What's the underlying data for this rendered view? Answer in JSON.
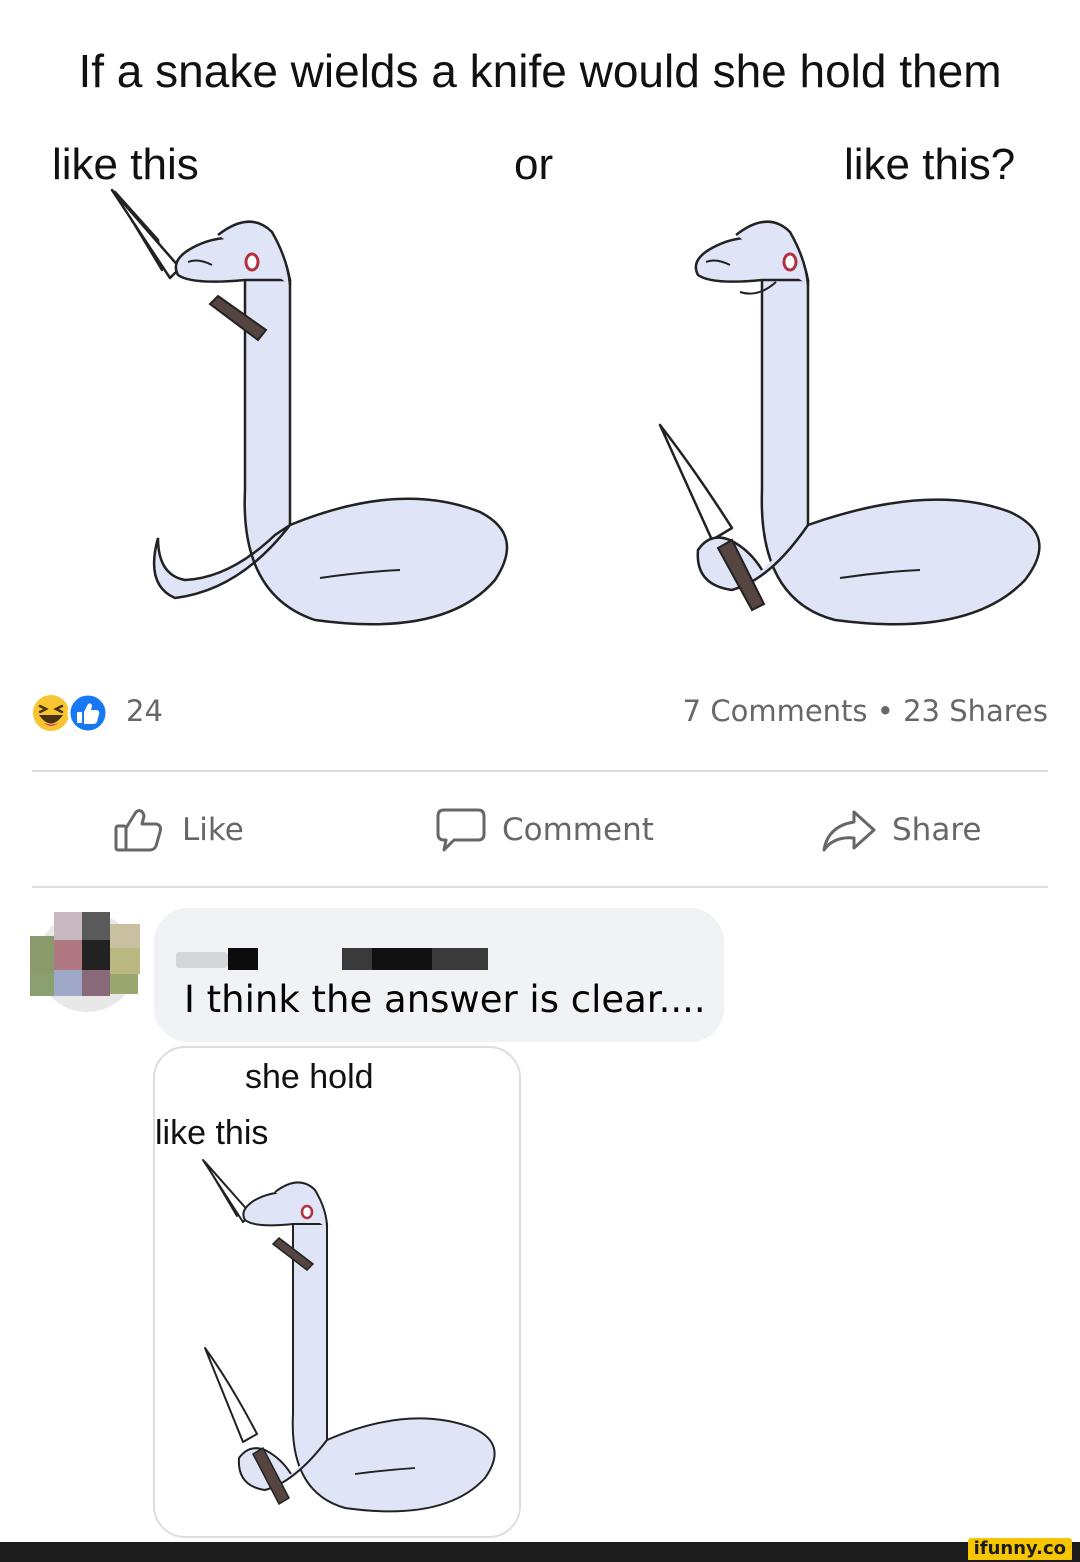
{
  "meme": {
    "title": "If a snake wields a knife would she hold them",
    "label_left": "like this",
    "label_middle": "or",
    "label_right": "like this?"
  },
  "post_stats": {
    "reaction_icons": [
      "laughing-emoji-icon",
      "like-thumb-icon"
    ],
    "reaction_count": "24",
    "comments_shares": "7 Comments • 23 Shares"
  },
  "actions": {
    "like_label": "Like",
    "comment_label": "Comment",
    "share_label": "Share"
  },
  "comment": {
    "text": "I think the answer is clear....",
    "attachment": {
      "line1": "she hold",
      "line2": "like this"
    }
  },
  "watermark": "ifunny.co",
  "colors": {
    "snake_fill": "#dfe4f7",
    "secondary_text": "#65676b",
    "bubble_bg": "#f0f2f5",
    "divider": "#dadde1",
    "like_blue": "#1877f2",
    "watermark_yellow": "#f7c600"
  }
}
